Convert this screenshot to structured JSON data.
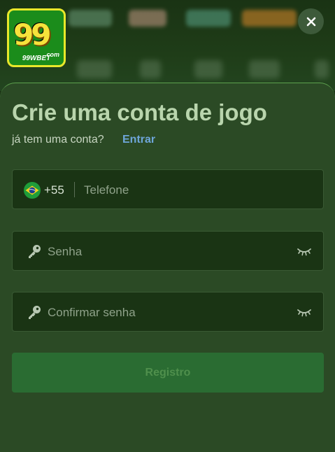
{
  "brand": {
    "logo_number": "99",
    "logo_domain": ".com",
    "logo_name": "99WBET"
  },
  "dialog": {
    "title": "Crie uma conta de jogo",
    "subtitle": "já tem uma conta?",
    "login_link": "Entrar",
    "close_icon": "close-icon"
  },
  "form": {
    "phone": {
      "country_flag": "brazil-flag-icon",
      "country_code": "+55",
      "placeholder": "Telefone"
    },
    "password": {
      "icon": "key-icon",
      "placeholder": "Senha",
      "toggle_icon": "eye-closed-icon"
    },
    "confirm_password": {
      "icon": "key-icon",
      "placeholder": "Confirmar senha",
      "toggle_icon": "eye-closed-icon"
    },
    "submit_label": "Registro"
  },
  "colors": {
    "panel_bg": "#2b4a25",
    "field_bg": "#1a3414",
    "title": "#b9d5ad",
    "link": "#6ea6d9",
    "button_bg": "#2a6c32",
    "button_text": "#4f8f4c",
    "logo_border": "#e8e82a"
  }
}
